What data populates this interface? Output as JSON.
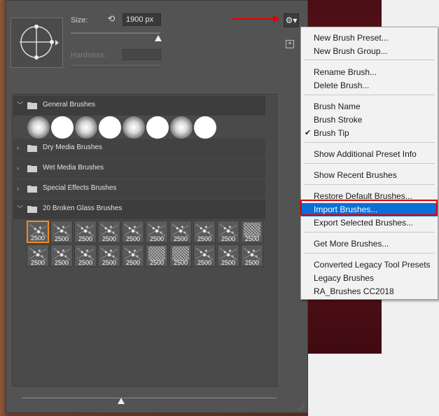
{
  "brush_panel": {
    "size_label": "Size:",
    "size_value": "1900 px",
    "hardness_label": "Hardness:",
    "size_slider_value": 0.98,
    "bottom_slider_value": 0.39,
    "icons": {
      "reset": "reset-size-icon",
      "gear": "gear-icon",
      "new_group": "new-brush-group-icon"
    }
  },
  "groups": [
    {
      "label": "General Brushes",
      "expanded": true
    },
    {
      "label": "Dry Media Brushes",
      "expanded": false
    },
    {
      "label": "Wet Media Brushes",
      "expanded": false
    },
    {
      "label": "Special Effects Brushes",
      "expanded": false
    },
    {
      "label": "20 Broken Glass Brushes",
      "expanded": true
    }
  ],
  "general_tips": [
    "soft",
    "hard",
    "soft",
    "hard",
    "soft",
    "hard",
    "soft",
    "hard"
  ],
  "glass_brushes": {
    "sizes": [
      "2500",
      "2500",
      "2500",
      "2500",
      "2500",
      "2500",
      "2500",
      "2500",
      "2500",
      "2500",
      "2500",
      "2500",
      "2500",
      "2500",
      "2500",
      "2500",
      "2500",
      "2500",
      "2500",
      "2500"
    ],
    "selected_index": 0
  },
  "menu": {
    "items": [
      {
        "label": "New Brush Preset...",
        "checked": false,
        "highlighted": false
      },
      {
        "label": "New Brush Group...",
        "checked": false,
        "highlighted": false
      },
      {
        "label": "Rename Brush...",
        "checked": false,
        "highlighted": false
      },
      {
        "label": "Delete Brush...",
        "checked": false,
        "highlighted": false
      },
      {
        "label": "Brush Name",
        "checked": false,
        "highlighted": false
      },
      {
        "label": "Brush Stroke",
        "checked": false,
        "highlighted": false
      },
      {
        "label": "Brush Tip",
        "checked": true,
        "highlighted": false
      },
      {
        "label": "Show Additional Preset Info",
        "checked": false,
        "highlighted": false
      },
      {
        "label": "Show Recent Brushes",
        "checked": false,
        "highlighted": false
      },
      {
        "label": "Restore Default Brushes...",
        "checked": false,
        "highlighted": false
      },
      {
        "label": "Import Brushes...",
        "checked": false,
        "highlighted": true
      },
      {
        "label": "Export Selected Brushes...",
        "checked": false,
        "highlighted": false
      },
      {
        "label": "Get More Brushes...",
        "checked": false,
        "highlighted": false
      },
      {
        "label": "Converted Legacy Tool Presets",
        "checked": false,
        "highlighted": false
      },
      {
        "label": "Legacy Brushes",
        "checked": false,
        "highlighted": false
      },
      {
        "label": "RA_Brushes CC2018",
        "checked": false,
        "highlighted": false
      }
    ]
  },
  "colors": {
    "highlight": "#0a6fd6",
    "annotation": "#e00000",
    "selected_tile": "#f28b1e"
  }
}
